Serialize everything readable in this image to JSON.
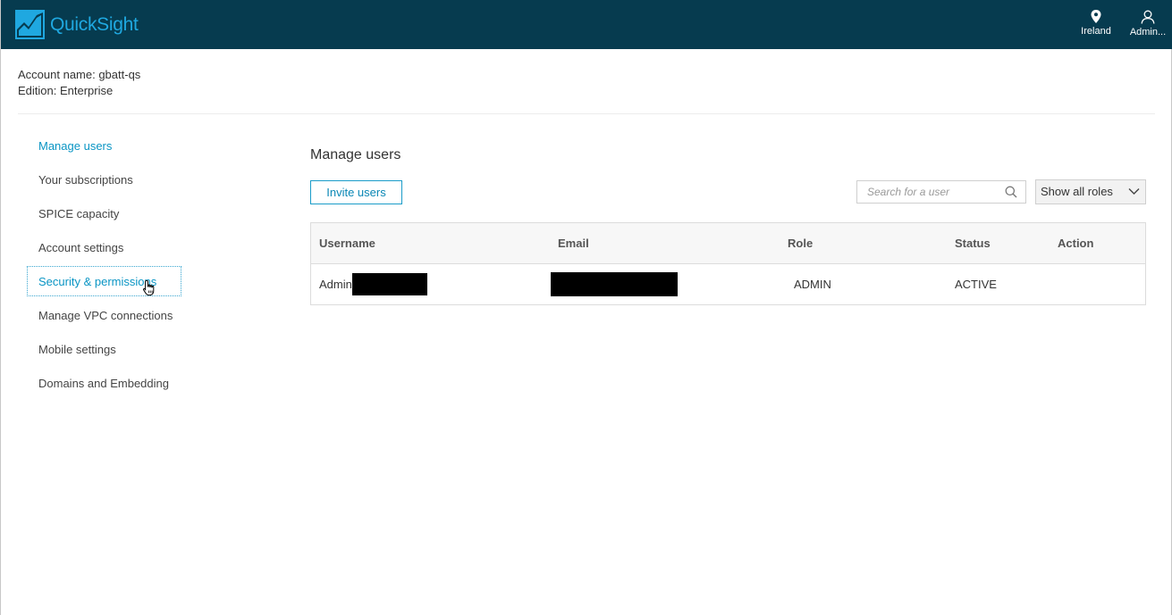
{
  "header": {
    "logo_text": "QuickSight",
    "region_label": "Ireland",
    "user_label": "Admin..."
  },
  "account": {
    "name_line": "Account name: gbatt-qs",
    "edition_line": "Edition: Enterprise"
  },
  "sidebar": {
    "items": [
      {
        "label": "Manage users"
      },
      {
        "label": "Your subscriptions"
      },
      {
        "label": "SPICE capacity"
      },
      {
        "label": "Account settings"
      },
      {
        "label": "Security & permissions"
      },
      {
        "label": "Manage VPC connections"
      },
      {
        "label": "Mobile settings"
      },
      {
        "label": "Domains and Embedding"
      }
    ],
    "active_index": 0,
    "focused_index": 4
  },
  "main": {
    "title": "Manage users",
    "invite_label": "Invite users",
    "search_placeholder": "Search for a user",
    "role_filter": "Show all roles"
  },
  "table": {
    "headers": {
      "username": "Username",
      "email": "Email",
      "role": "Role",
      "status": "Status",
      "action": "Action"
    },
    "rows": [
      {
        "username": "Admin/",
        "email": "",
        "role": "ADMIN",
        "status": "ACTIVE",
        "action": ""
      }
    ]
  },
  "colors": {
    "topbar": "#063b4f",
    "accent": "#0a95c4",
    "logo": "#1fa8e0"
  }
}
